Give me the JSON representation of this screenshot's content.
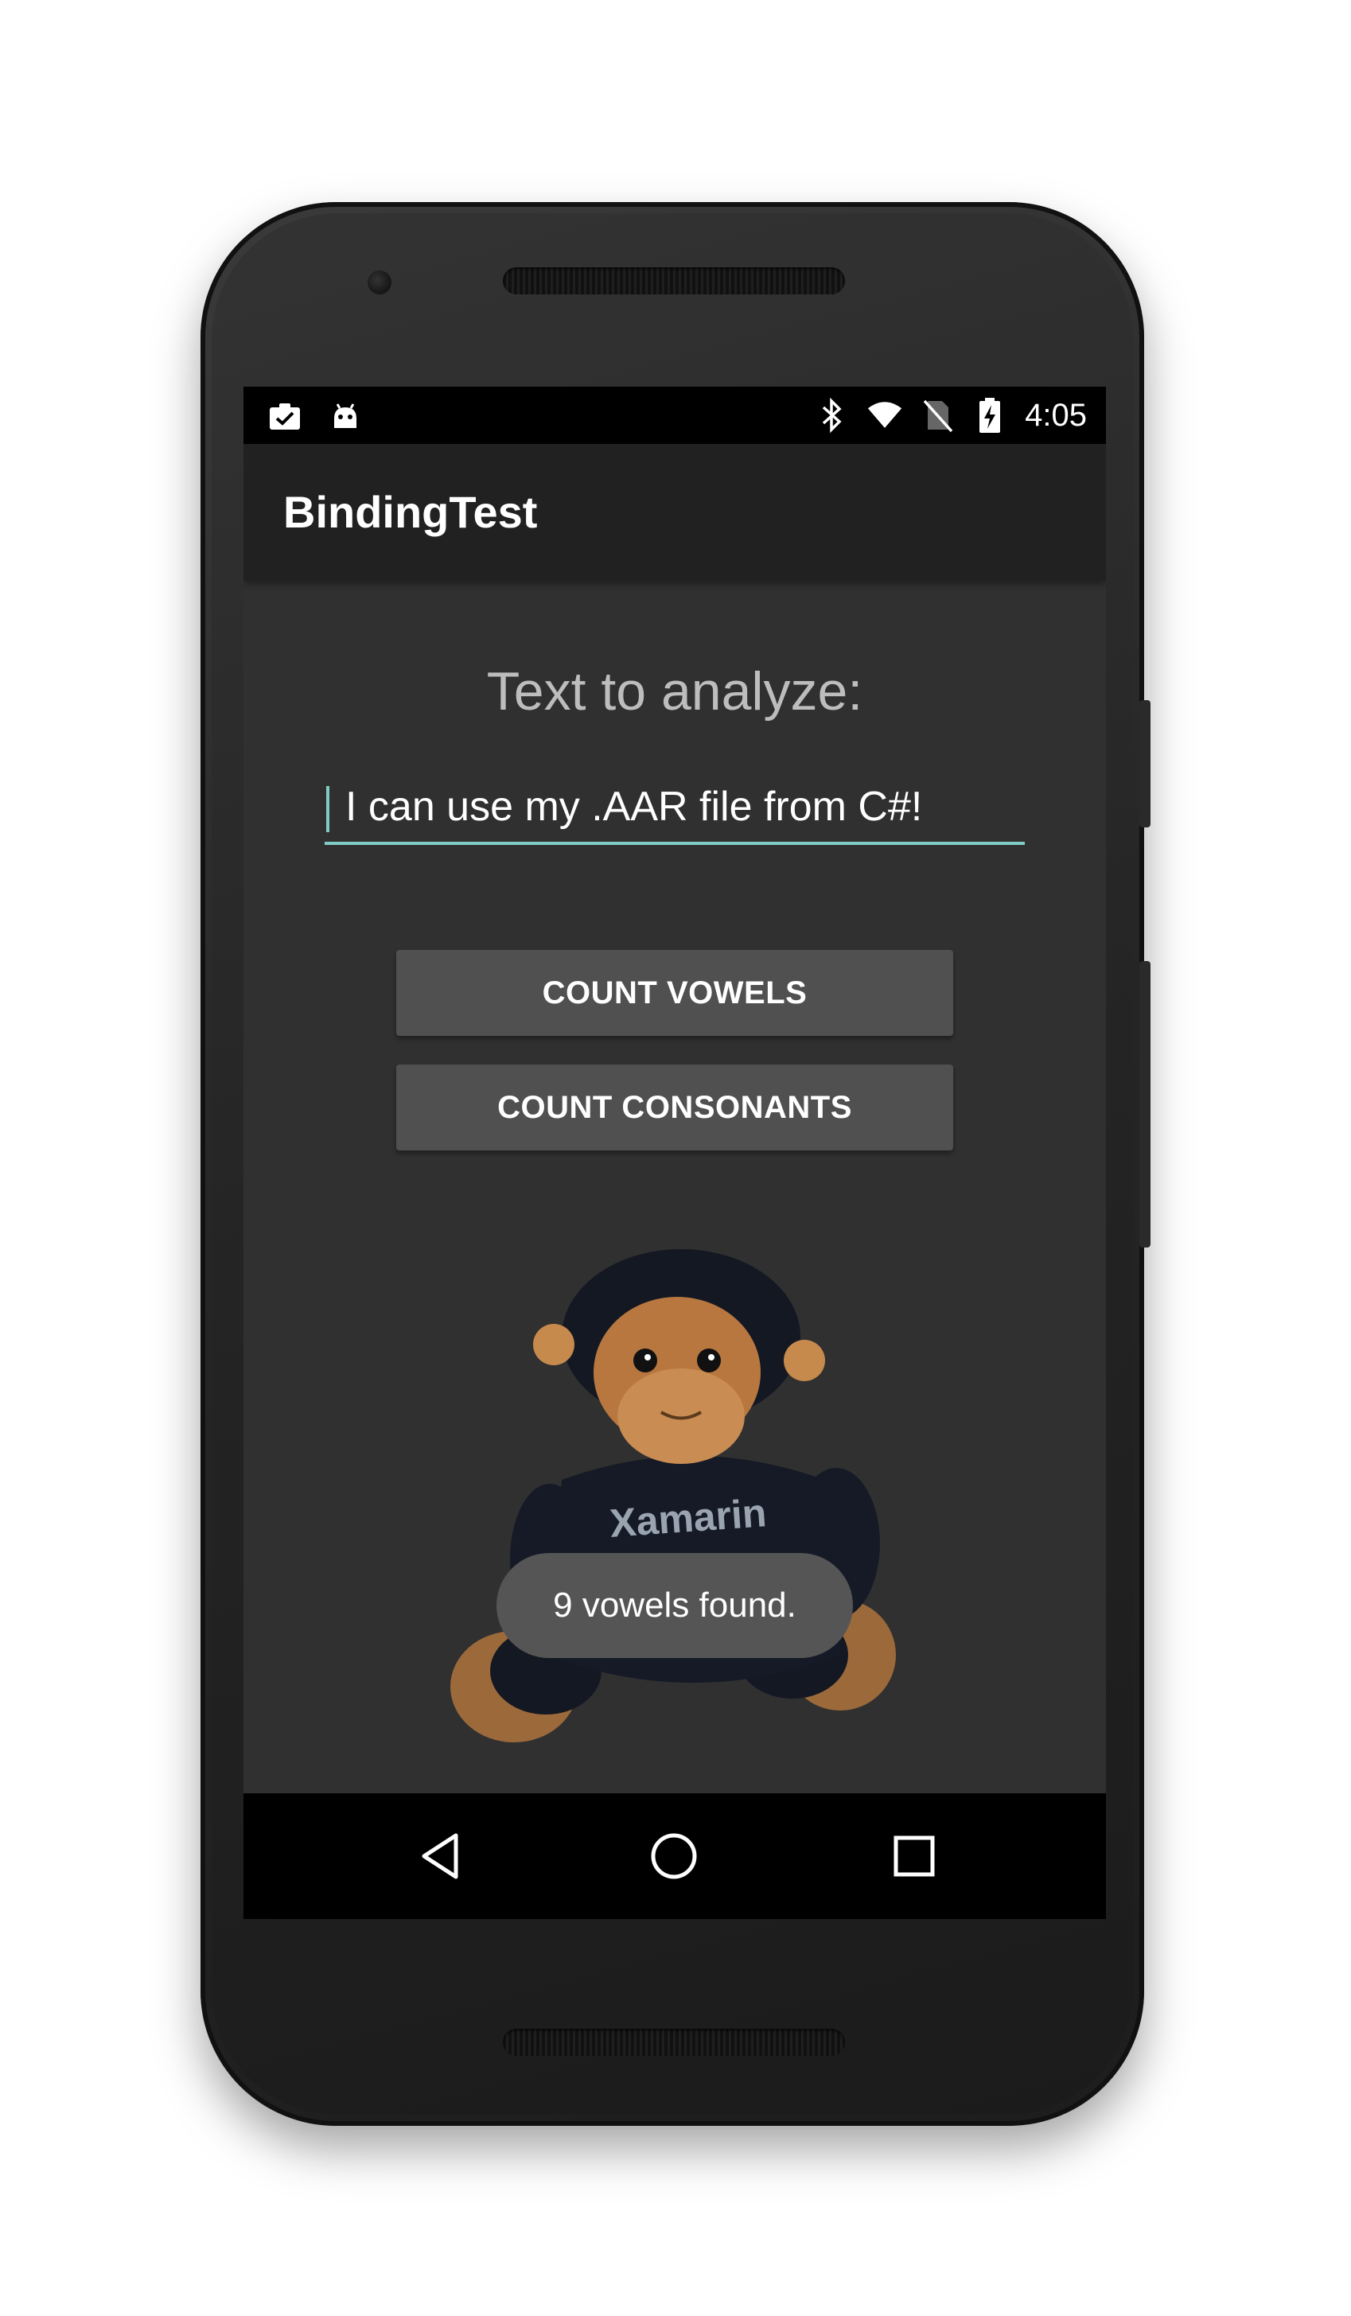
{
  "status_bar": {
    "time": "4:05",
    "left_icons": [
      "clipboard-check-icon",
      "android-debug-icon"
    ],
    "right_icons": [
      "bluetooth-icon",
      "wifi-icon",
      "no-sim-icon",
      "battery-charging-icon"
    ]
  },
  "app_bar": {
    "title": "BindingTest"
  },
  "main": {
    "prompt": "Text to analyze:",
    "input_value": "I can use my .AAR file from C#!",
    "accent_color": "#80cbc4",
    "count_vowels_label": "COUNT VOWELS",
    "count_consonants_label": "COUNT CONSONANTS",
    "image_caption_text": "Xamarin"
  },
  "toast": {
    "message": "9 vowels found."
  },
  "nav_bar": {
    "icons": [
      "back-icon",
      "home-icon",
      "recents-icon"
    ]
  }
}
